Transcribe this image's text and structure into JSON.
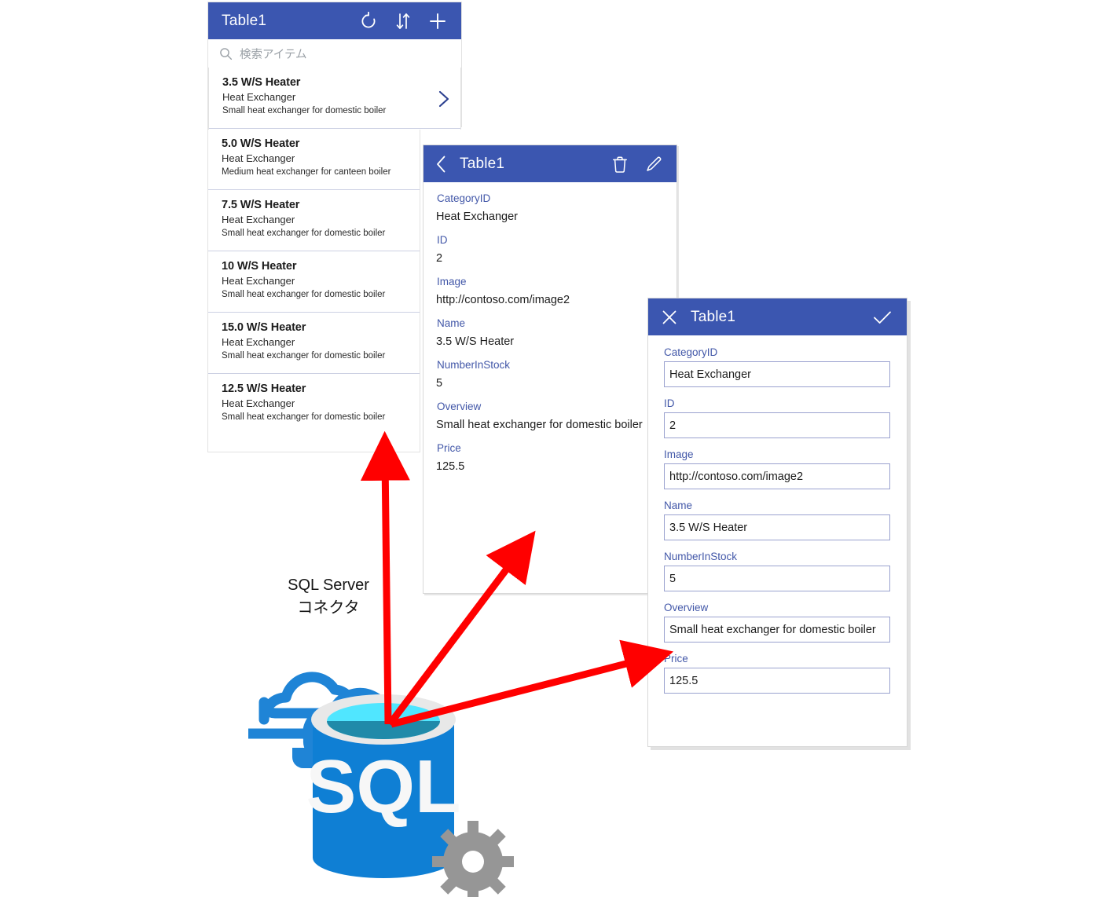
{
  "gallery": {
    "title": "Table1",
    "icons": [
      "refresh-icon",
      "sort-icon",
      "add-icon"
    ],
    "search": {
      "placeholder": "検索アイテム",
      "icon": "search-icon"
    },
    "items": [
      {
        "title": "3.5 W/S Heater",
        "category": "Heat Exchanger",
        "overview": "Small heat exchanger for domestic boiler"
      },
      {
        "title": "5.0 W/S Heater",
        "category": "Heat Exchanger",
        "overview": "Medium heat exchanger for canteen boiler"
      },
      {
        "title": "7.5 W/S Heater",
        "category": "Heat Exchanger",
        "overview": "Small heat exchanger for domestic boiler"
      },
      {
        "title": "10 W/S Heater",
        "category": "Heat Exchanger",
        "overview": "Small heat exchanger for domestic boiler"
      },
      {
        "title": "15.0 W/S Heater",
        "category": "Heat Exchanger",
        "overview": "Small heat exchanger for domestic boiler"
      },
      {
        "title": "12.5 W/S Heater",
        "category": "Heat Exchanger",
        "overview": "Small heat exchanger for domestic boiler"
      }
    ]
  },
  "detail": {
    "title": "Table1",
    "icons": [
      "back-chevron-icon",
      "trash-icon",
      "edit-pencil-icon"
    ],
    "fields": [
      {
        "label": "CategoryID",
        "value": "Heat Exchanger"
      },
      {
        "label": "ID",
        "value": "2"
      },
      {
        "label": "Image",
        "value": "http://contoso.com/image2"
      },
      {
        "label": "Name",
        "value": "3.5 W/S Heater"
      },
      {
        "label": "NumberInStock",
        "value": "5"
      },
      {
        "label": "Overview",
        "value": "Small heat exchanger for domestic boiler"
      },
      {
        "label": "Price",
        "value": "125.5"
      }
    ]
  },
  "edit": {
    "title": "Table1",
    "icons": [
      "close-x-icon",
      "checkmark-icon"
    ],
    "fields": [
      {
        "label": "CategoryID",
        "value": "Heat Exchanger"
      },
      {
        "label": "ID",
        "value": "2"
      },
      {
        "label": "Image",
        "value": "http://contoso.com/image2"
      },
      {
        "label": "Name",
        "value": "3.5 W/S Heater"
      },
      {
        "label": "NumberInStock",
        "value": "5"
      },
      {
        "label": "Overview",
        "value": "Small heat exchanger for domestic boiler"
      },
      {
        "label": "Price",
        "value": "125.5"
      }
    ]
  },
  "connector": {
    "line1": "SQL Server",
    "line2": "コネクタ",
    "graphic_label": "SQL",
    "graphic_name": "azure-sql-database-icon"
  },
  "colors": {
    "header_blue": "#3b56b0",
    "label_blue": "#4257a8",
    "arrow_red": "#ff0000",
    "sql_blue": "#0f7fd4",
    "sql_cyan": "#50e6ff",
    "gear_gray": "#969696"
  }
}
